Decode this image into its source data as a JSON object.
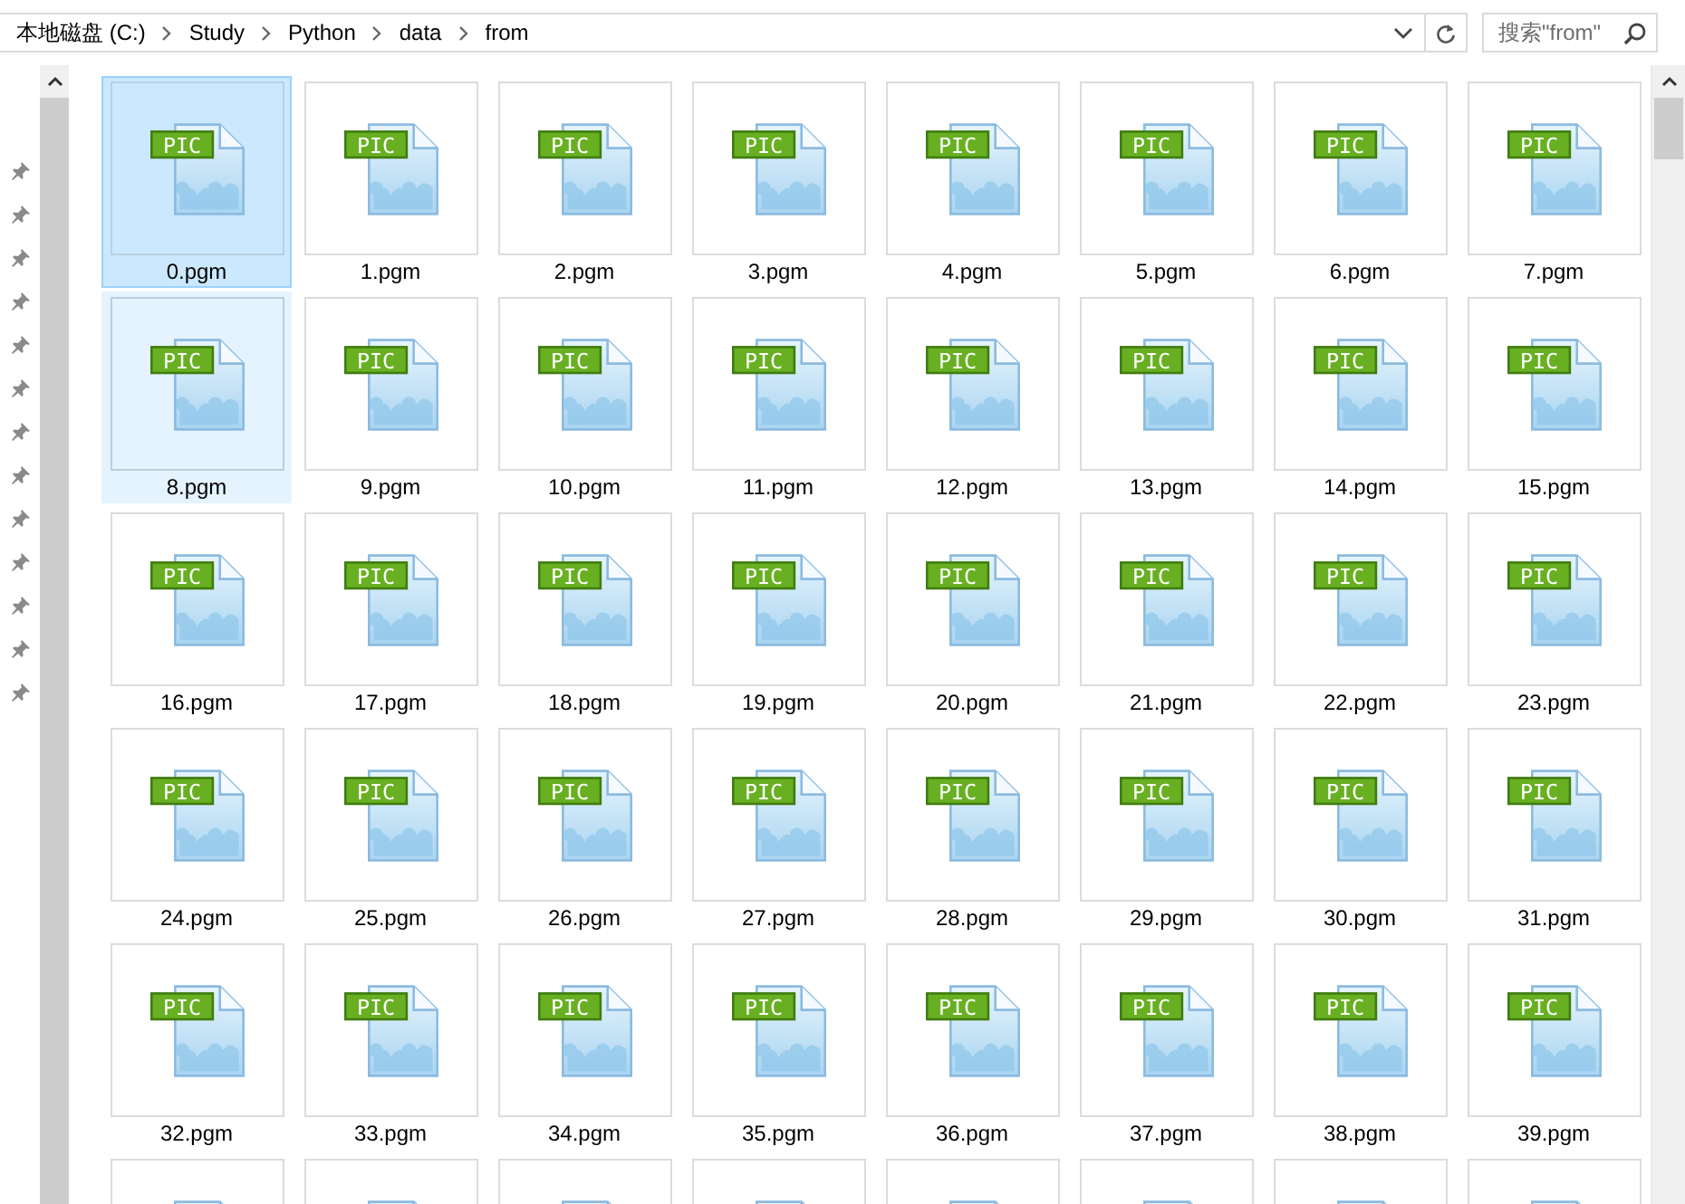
{
  "address_bar": {
    "crumbs": [
      "本地磁盘 (C:)",
      "Study",
      "Python",
      "data",
      "from"
    ]
  },
  "search": {
    "placeholder": "搜索\"from\""
  },
  "nav_pane": [
    {
      "pinned": true
    },
    {
      "pinned": true
    },
    {
      "pinned": true
    },
    {
      "pinned": true
    },
    {
      "pinned": true
    },
    {
      "pinned": true
    },
    {
      "pinned": true
    },
    {
      "pinned": true
    },
    {
      "pinned": true
    },
    {
      "pinned": true
    },
    {
      "pinned": true
    },
    {
      "pinned": true
    },
    {
      "pinned": true
    }
  ],
  "files": [
    {
      "kind": "file",
      "name": "0.pgm",
      "badge": "PIC",
      "selected": true,
      "hovered": false
    },
    {
      "kind": "file",
      "name": "1.pgm",
      "badge": "PIC",
      "selected": false,
      "hovered": false
    },
    {
      "kind": "file",
      "name": "2.pgm",
      "badge": "PIC",
      "selected": false,
      "hovered": false
    },
    {
      "kind": "file",
      "name": "3.pgm",
      "badge": "PIC",
      "selected": false,
      "hovered": false
    },
    {
      "kind": "file",
      "name": "4.pgm",
      "badge": "PIC",
      "selected": false,
      "hovered": false
    },
    {
      "kind": "file",
      "name": "5.pgm",
      "badge": "PIC",
      "selected": false,
      "hovered": false
    },
    {
      "kind": "file",
      "name": "6.pgm",
      "badge": "PIC",
      "selected": false,
      "hovered": false
    },
    {
      "kind": "file",
      "name": "7.pgm",
      "badge": "PIC",
      "selected": false,
      "hovered": false
    },
    {
      "kind": "file",
      "name": "8.pgm",
      "badge": "PIC",
      "selected": false,
      "hovered": true
    },
    {
      "kind": "file",
      "name": "9.pgm",
      "badge": "PIC",
      "selected": false,
      "hovered": false
    },
    {
      "kind": "file",
      "name": "10.pgm",
      "badge": "PIC",
      "selected": false,
      "hovered": false
    },
    {
      "kind": "file",
      "name": "11.pgm",
      "badge": "PIC",
      "selected": false,
      "hovered": false
    },
    {
      "kind": "file",
      "name": "12.pgm",
      "badge": "PIC",
      "selected": false,
      "hovered": false
    },
    {
      "kind": "file",
      "name": "13.pgm",
      "badge": "PIC",
      "selected": false,
      "hovered": false
    },
    {
      "kind": "file",
      "name": "14.pgm",
      "badge": "PIC",
      "selected": false,
      "hovered": false
    },
    {
      "kind": "file",
      "name": "15.pgm",
      "badge": "PIC",
      "selected": false,
      "hovered": false
    },
    {
      "kind": "file",
      "name": "16.pgm",
      "badge": "PIC",
      "selected": false,
      "hovered": false
    },
    {
      "kind": "file",
      "name": "17.pgm",
      "badge": "PIC",
      "selected": false,
      "hovered": false
    },
    {
      "kind": "file",
      "name": "18.pgm",
      "badge": "PIC",
      "selected": false,
      "hovered": false
    },
    {
      "kind": "file",
      "name": "19.pgm",
      "badge": "PIC",
      "selected": false,
      "hovered": false
    },
    {
      "kind": "file",
      "name": "20.pgm",
      "badge": "PIC",
      "selected": false,
      "hovered": false
    },
    {
      "kind": "file",
      "name": "21.pgm",
      "badge": "PIC",
      "selected": false,
      "hovered": false
    },
    {
      "kind": "file",
      "name": "22.pgm",
      "badge": "PIC",
      "selected": false,
      "hovered": false
    },
    {
      "kind": "file",
      "name": "23.pgm",
      "badge": "PIC",
      "selected": false,
      "hovered": false
    },
    {
      "kind": "file",
      "name": "24.pgm",
      "badge": "PIC",
      "selected": false,
      "hovered": false
    },
    {
      "kind": "file",
      "name": "25.pgm",
      "badge": "PIC",
      "selected": false,
      "hovered": false
    },
    {
      "kind": "file",
      "name": "26.pgm",
      "badge": "PIC",
      "selected": false,
      "hovered": false
    },
    {
      "kind": "file",
      "name": "27.pgm",
      "badge": "PIC",
      "selected": false,
      "hovered": false
    },
    {
      "kind": "file",
      "name": "28.pgm",
      "badge": "PIC",
      "selected": false,
      "hovered": false
    },
    {
      "kind": "file",
      "name": "29.pgm",
      "badge": "PIC",
      "selected": false,
      "hovered": false
    },
    {
      "kind": "file",
      "name": "30.pgm",
      "badge": "PIC",
      "selected": false,
      "hovered": false
    },
    {
      "kind": "file",
      "name": "31.pgm",
      "badge": "PIC",
      "selected": false,
      "hovered": false
    },
    {
      "kind": "file",
      "name": "32.pgm",
      "badge": "PIC",
      "selected": false,
      "hovered": false
    },
    {
      "kind": "file",
      "name": "33.pgm",
      "badge": "PIC",
      "selected": false,
      "hovered": false
    },
    {
      "kind": "file",
      "name": "34.pgm",
      "badge": "PIC",
      "selected": false,
      "hovered": false
    },
    {
      "kind": "file",
      "name": "35.pgm",
      "badge": "PIC",
      "selected": false,
      "hovered": false
    },
    {
      "kind": "file",
      "name": "36.pgm",
      "badge": "PIC",
      "selected": false,
      "hovered": false
    },
    {
      "kind": "file",
      "name": "37.pgm",
      "badge": "PIC",
      "selected": false,
      "hovered": false
    },
    {
      "kind": "file",
      "name": "38.pgm",
      "badge": "PIC",
      "selected": false,
      "hovered": false
    },
    {
      "kind": "file",
      "name": "39.pgm",
      "badge": "PIC",
      "selected": false,
      "hovered": false
    },
    {
      "kind": "cut",
      "selected": false,
      "hovered": false
    },
    {
      "kind": "cut",
      "selected": false,
      "hovered": false
    },
    {
      "kind": "cut",
      "selected": false,
      "hovered": false
    },
    {
      "kind": "cut",
      "selected": false,
      "hovered": false
    },
    {
      "kind": "cut",
      "selected": false,
      "hovered": false
    },
    {
      "kind": "cut",
      "selected": false,
      "hovered": false
    },
    {
      "kind": "cut",
      "selected": false,
      "hovered": false
    },
    {
      "kind": "cut",
      "selected": false,
      "hovered": false
    }
  ]
}
